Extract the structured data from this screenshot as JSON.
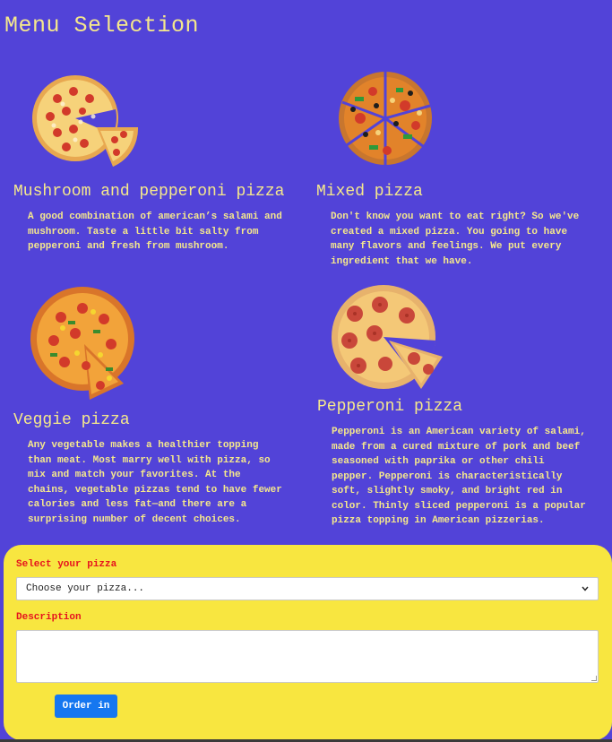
{
  "page": {
    "title": "Menu Selection"
  },
  "pizzas": [
    {
      "name": "Mushroom and pepperoni pizza",
      "description": "A good combination of american’s salami and mushroom. Taste a little bit salty from pepperoni and fresh from mushroom.",
      "icon": "mushroom-pepperoni-pizza-image"
    },
    {
      "name": "Mixed pizza",
      "description": "Don't know you want to eat right? So we've created a mixed pizza. You going to have many flavors and feelings. We put every ingredient that we have.",
      "icon": "mixed-pizza-image"
    },
    {
      "name": "Veggie pizza",
      "description": "Any vegetable makes a healthier topping than meat. Most marry well with pizza, so mix and match your favorites. At the chains, vegetable pizzas tend to have fewer calories and less fat—and there are a surprising number of decent choices.",
      "icon": "veggie-pizza-image"
    },
    {
      "name": "Pepperoni pizza",
      "description": "Pepperoni is an American variety of salami, made from a cured mixture of pork and beef seasoned with paprika or other chili pepper. Pepperoni is characteristically soft, slightly smoky, and bright red in color. Thinly sliced pepperoni is a popular pizza topping in American pizzerias.",
      "icon": "pepperoni-pizza-image"
    }
  ],
  "order_form": {
    "select_label": "Select your pizza",
    "select_value": "Choose your pizza...",
    "description_label": "Description",
    "description_value": "",
    "submit_label": "Order in"
  },
  "colors": {
    "background": "#5243d8",
    "text": "#f5e88c",
    "panel": "#f8e640",
    "label": "#e6121e",
    "button": "#1577f0"
  }
}
